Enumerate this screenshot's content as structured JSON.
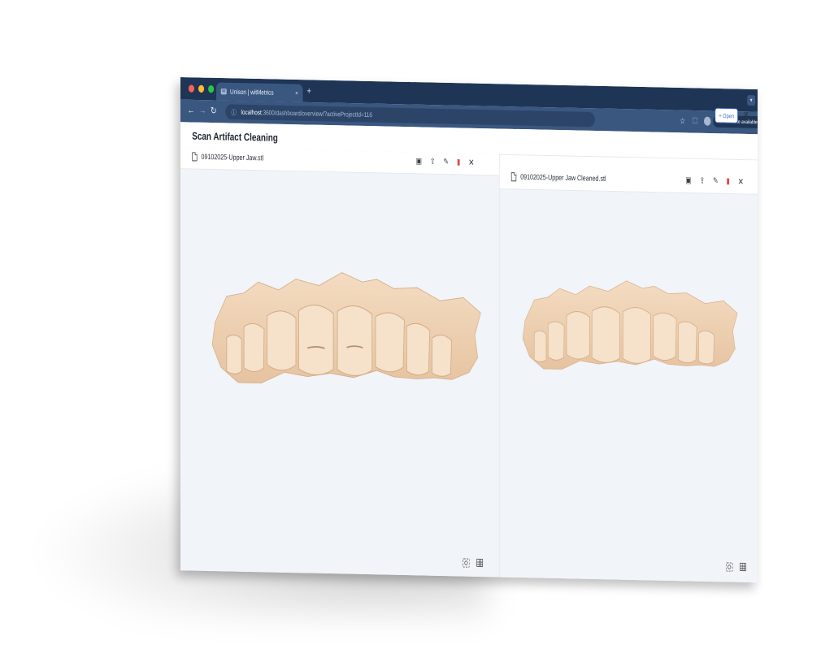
{
  "browser": {
    "tab_title": "Unison | witMetrics",
    "tab_favicon_text": "W",
    "tab_close": "×",
    "new_tab": "+",
    "url_host": "localhost",
    "url_path": ":3600/dashboard/overview/?activeProjectId=116",
    "update_label": "New Chrome available"
  },
  "app": {
    "page_title": "Scan Artifact Cleaning",
    "open_button_label": "Open",
    "open_button_icon": "+"
  },
  "panels": {
    "left": {
      "file_name": "09102025-Upper Jaw.stl"
    },
    "right": {
      "file_name": "09102025-Upper Jaw Cleaned.stl"
    }
  },
  "colors": {
    "model_fill": "#f0d3b4",
    "model_shade": "#d9b38f",
    "chrome_dark": "#1f3556",
    "chrome_mid": "#3a5780",
    "accent": "#3b6fd6",
    "danger": "#e24a4a"
  }
}
